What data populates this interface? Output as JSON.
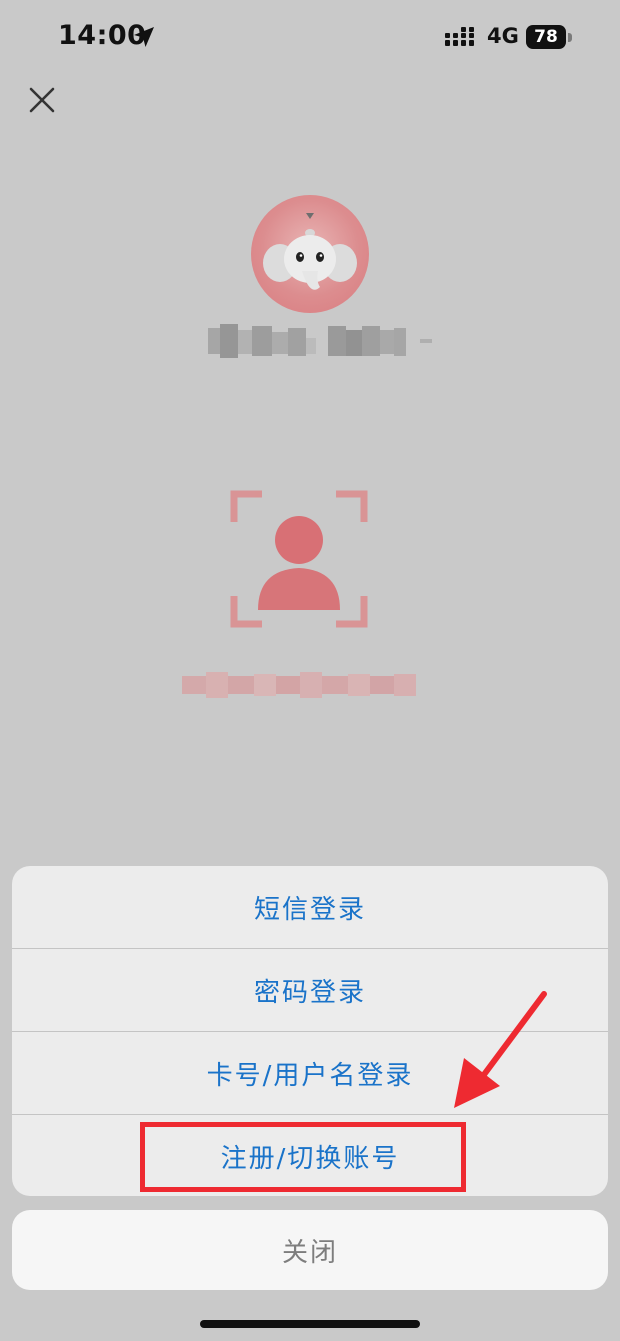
{
  "status_bar": {
    "time": "14:00",
    "network": "4G",
    "battery_level": "78"
  },
  "close_icon": "close-icon",
  "avatar_icon": "elephant-mascot-icon",
  "face_scan_icon": "face-scan-icon",
  "action_sheet": {
    "items": [
      {
        "label": "短信登录"
      },
      {
        "label": "密码登录"
      },
      {
        "label": "卡号/用户名登录"
      },
      {
        "label": "注册/切换账号"
      }
    ],
    "close_label": "关闭"
  },
  "colors": {
    "accent": "#1a73c9",
    "annotation_red": "#ee2a31",
    "overlay_background": "#c9c9c9",
    "brand_red": "#d9666b"
  }
}
